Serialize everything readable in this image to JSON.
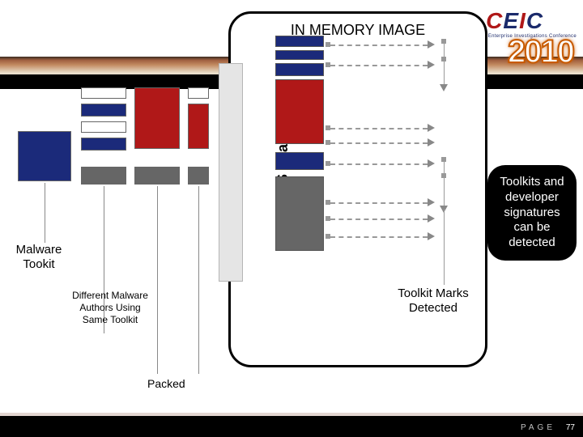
{
  "header": {
    "logo_main": "CEIC",
    "logo_tag": "Computer and Enterprise Investigations Conference",
    "year": "2010"
  },
  "mem": {
    "title": "IN MEMORY IMAGE",
    "os_loader": "OS Loader",
    "marks_label": "Toolkit Marks Detected"
  },
  "left": {
    "malware_toolkit": "Malware Tookit",
    "different_authors": "Different Malware Authors Using Same Toolkit",
    "packed": "Packed"
  },
  "callout": {
    "text": "Toolkits and developer signatures can be detected"
  },
  "footer": {
    "page_word": "PAGE",
    "page_num": "77"
  },
  "colors": {
    "blue": "#1b2a7a",
    "red": "#b01818",
    "gray": "#666666"
  }
}
